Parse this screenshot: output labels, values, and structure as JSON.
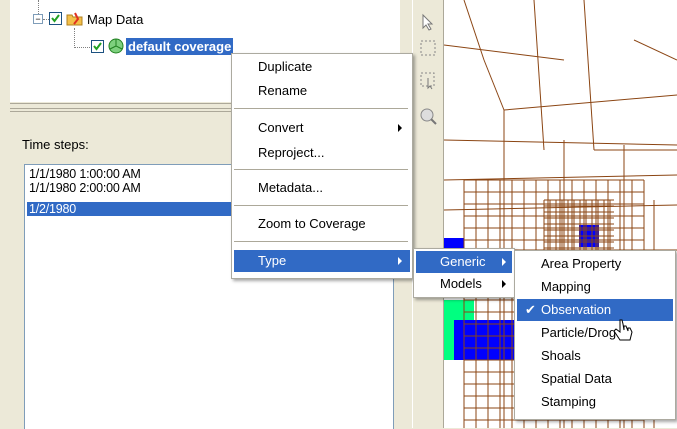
{
  "tree": {
    "root_label": "Map Data",
    "child_label": "default coverage"
  },
  "time_steps": {
    "label": "Time steps:",
    "items": [
      "1/1/1980 1:00:00 AM",
      "1/1/1980 2:00:00 AM",
      "1/2/1980"
    ],
    "selected_index": 2
  },
  "context_menu": {
    "items": [
      "Duplicate",
      "Rename",
      "Convert",
      "Reproject...",
      "Metadata...",
      "Zoom to Coverage",
      "Type"
    ]
  },
  "type_submenu": {
    "items": [
      "Generic",
      "Models"
    ]
  },
  "generic_submenu": {
    "items": [
      "Area Property",
      "Mapping",
      "Observation",
      "Particle/Drogue",
      "Shoals",
      "Spatial Data",
      "Stamping"
    ],
    "checked": "Observation"
  },
  "colors": {
    "highlight": "#316ac5",
    "grid_lines": "#8b4513",
    "mesh_blue": "#0000ff",
    "mesh_green": "#00ff80"
  }
}
